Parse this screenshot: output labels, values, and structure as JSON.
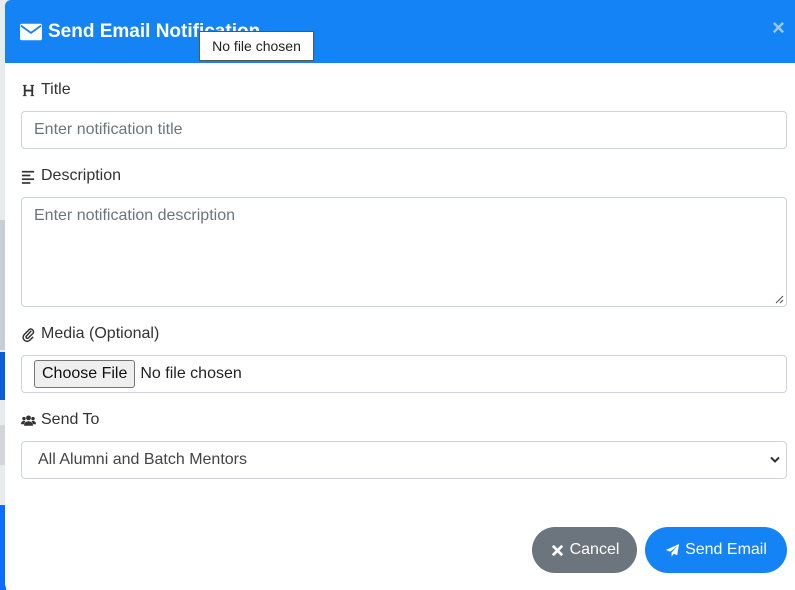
{
  "modal": {
    "title": "Send Email Notification",
    "close_symbol": "×",
    "tooltip": "No file chosen"
  },
  "form": {
    "title": {
      "label": "Title",
      "placeholder": "Enter notification title",
      "icon": "heading-icon"
    },
    "description": {
      "label": "Description",
      "placeholder": "Enter notification description",
      "icon": "align-left-icon"
    },
    "media": {
      "label": "Media (Optional)",
      "button": "Choose File",
      "status": "No file chosen",
      "icon": "paperclip-icon"
    },
    "send_to": {
      "label": "Send To",
      "selected": "All Alumni and Batch Mentors",
      "icon": "users-icon"
    }
  },
  "actions": {
    "cancel": "Cancel",
    "send": "Send Email"
  },
  "colors": {
    "primary": "#1383f5",
    "secondary": "#6c757d"
  }
}
